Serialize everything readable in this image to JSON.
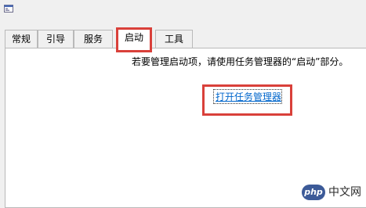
{
  "window": {
    "icon": "msconfig-app-icon"
  },
  "tabs": [
    {
      "label": "常规",
      "active": false
    },
    {
      "label": "引导",
      "active": false
    },
    {
      "label": "服务",
      "active": false
    },
    {
      "label": "启动",
      "active": true
    },
    {
      "label": "工具",
      "active": false
    }
  ],
  "startup_panel": {
    "info_text": "若要管理启动项，请使用任务管理器的“启动”部分。",
    "link_label": "打开任务管理器"
  },
  "annotation_color": "#d9403a",
  "link_color": "#0066cc",
  "watermark": {
    "logo_text": "php",
    "text": "中文网"
  }
}
